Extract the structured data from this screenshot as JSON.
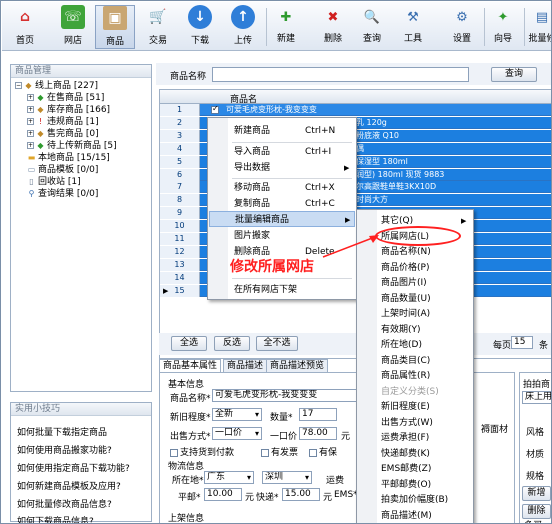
{
  "toolbar": {
    "items": [
      {
        "label": "首页",
        "icon": "home-icon"
      },
      {
        "label": "网店",
        "icon": "shop-icon"
      },
      {
        "label": "商品",
        "icon": "box-icon"
      },
      {
        "label": "交易",
        "icon": "cart-icon"
      },
      {
        "label": "下载",
        "icon": "download-icon"
      },
      {
        "label": "上传",
        "icon": "upload-icon"
      }
    ],
    "small_items": [
      {
        "label": "新建",
        "icon": "plus-icon"
      },
      {
        "label": "删除",
        "icon": "delete-icon"
      },
      {
        "label": "查询",
        "icon": "search-icon"
      },
      {
        "label": "工具",
        "icon": "tools-icon"
      },
      {
        "label": "设置",
        "icon": "settings-icon"
      },
      {
        "label": "向导",
        "icon": "wizard-icon"
      },
      {
        "label": "批量修",
        "icon": "batch-edit-icon"
      }
    ]
  },
  "left": {
    "title": "商品管理",
    "tree": [
      {
        "label": "线上商品 [227]",
        "level": 0
      },
      {
        "label": "在售商品 [51]",
        "level": 1
      },
      {
        "label": "库存商品 [166]",
        "level": 1
      },
      {
        "label": "违规商品 [1]",
        "level": 1
      },
      {
        "label": "售完商品 [0]",
        "level": 1
      },
      {
        "label": "待上传新商品 [5]",
        "level": 1
      },
      {
        "label": "本地商品 [15/15]",
        "level": 0
      },
      {
        "label": "商品模板 [0/0]",
        "level": 0
      },
      {
        "label": "回收站 [1]",
        "level": 0
      },
      {
        "label": "查询结果 [0/0]",
        "level": 0
      }
    ],
    "tips_title": "实用小技巧",
    "tips": [
      "如何批量下载指定商品",
      "如何使用商品搬家功能?",
      "如何使用指定商品下载功能?",
      "如何新建商品模板及应用?",
      "如何批量修改商品信息?",
      "如何下载商品信息?"
    ]
  },
  "search": {
    "label": "商品名称",
    "button": "查询"
  },
  "grid": {
    "header": "商品名",
    "rows": [
      {
        "n": "1",
        "name": "可爱毛虎变形枕-我变变变"
      },
      {
        "n": "2",
        "name": "乳 120g"
      },
      {
        "n": "3",
        "name": "粉底液 Q10"
      },
      {
        "n": "4",
        "name": "偶"
      },
      {
        "n": "5",
        "name": "保湿型 180ml"
      },
      {
        "n": "6",
        "name": "润型) 180ml 现货 9883"
      },
      {
        "n": "7",
        "name": "尔高跟鞋单鞋3KX10D"
      },
      {
        "n": "8",
        "name": "时尚大方"
      },
      {
        "n": "9",
        "name": ""
      },
      {
        "n": "10",
        "name": ""
      },
      {
        "n": "11",
        "name": ""
      },
      {
        "n": "12",
        "name": ""
      },
      {
        "n": "13",
        "name": ""
      },
      {
        "n": "14",
        "name": ""
      },
      {
        "n": "15",
        "name": ""
      }
    ],
    "footer": {
      "select_all": "全选",
      "invert": "反选",
      "none": "全不选",
      "per_page_label": "每页",
      "per_page": "15",
      "tail": "条"
    }
  },
  "tabs": [
    "商品基本属性",
    "商品描述",
    "商品描述预览"
  ],
  "form": {
    "section_basic": "基本信息",
    "name_label": "商品名称*",
    "name_value": "可爱毛虎变形枕-我变变变",
    "condition_label": "新旧程度*",
    "condition_value": "全新",
    "qty_label": "数量*",
    "qty_value": "17",
    "sale_label": "出售方式*",
    "sale_value": "一口价",
    "price_label": "一口价",
    "price_value": "78.00",
    "price_unit": "元",
    "check1": "支持货到付款",
    "check2": "有发票",
    "check3": "有保",
    "section_logistics": "物流信息",
    "loc_label": "所在地*",
    "province": "广东",
    "city": "深圳",
    "ship_label": "运费",
    "post_label": "平邮*",
    "post_value": "10.00",
    "post_unit": "元",
    "express_label": "快递*",
    "express_value": "15.00",
    "express_unit": "元",
    "ems_label": "EMS*",
    "section_listing": "上架信息"
  },
  "rpanel": {
    "lines": [
      "拍拍商",
      "床上用",
      "风格",
      "材质",
      "规格",
      "多买"
    ],
    "buttons": [
      "新增",
      "删除"
    ],
    "extra": "褥面材"
  },
  "context_menu": [
    {
      "label": "新建商品",
      "key": "Ctrl+N"
    },
    {
      "label": "导入商品",
      "key": "Ctrl+I"
    },
    {
      "label": "导出数据",
      "key": "",
      "sub": true
    },
    {
      "label": "移动商品",
      "key": "Ctrl+X"
    },
    {
      "label": "复制商品",
      "key": "Ctrl+C"
    },
    {
      "label": "批量编辑商品",
      "key": "",
      "sub": true,
      "highlight": true
    },
    {
      "label": "图片搬家",
      "key": ""
    },
    {
      "label": "删除商品",
      "key": "Delete"
    },
    {
      "label": "在所有网店下架",
      "key": ""
    }
  ],
  "submenu": [
    {
      "label": "其它(Q)",
      "sub": true
    },
    {
      "label": "所属网店(L)"
    },
    {
      "label": "商品名称(N)"
    },
    {
      "label": "商品价格(P)"
    },
    {
      "label": "商品图片(I)"
    },
    {
      "label": "商品数量(U)"
    },
    {
      "label": "上架时间(A)"
    },
    {
      "label": "有效期(Y)"
    },
    {
      "label": "所在地(D)"
    },
    {
      "label": "商品类目(C)"
    },
    {
      "label": "商品属性(R)"
    },
    {
      "label": "自定义分类(S)",
      "disabled": true
    },
    {
      "label": "新旧程度(E)"
    },
    {
      "label": "出售方式(W)"
    },
    {
      "label": "运费承担(F)"
    },
    {
      "label": "快递邮费(K)"
    },
    {
      "label": "EMS邮费(Z)"
    },
    {
      "label": "平邮邮费(O)"
    },
    {
      "label": "拍卖加价幅度(B)"
    },
    {
      "label": "商品描述(M)"
    }
  ],
  "annotation": "修改所属网店",
  "colors": {
    "accent": "#1c7fe0",
    "annotation": "#ff2020"
  }
}
